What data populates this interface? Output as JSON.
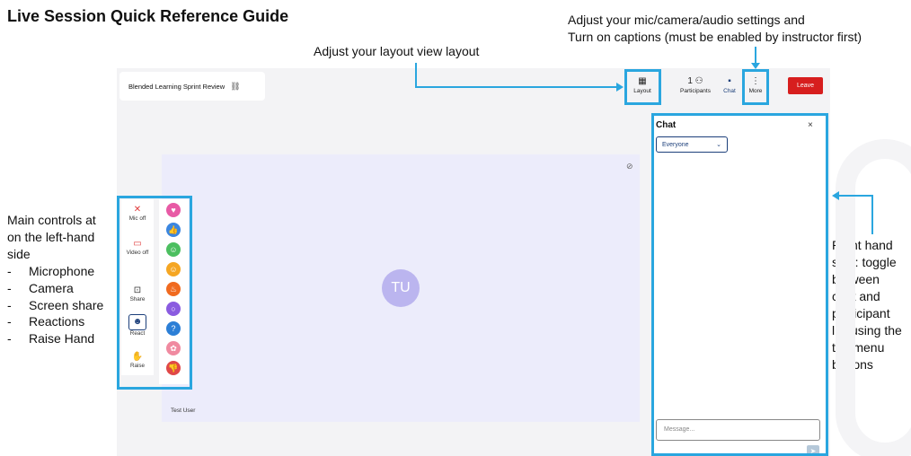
{
  "guide": {
    "title": "Live Session Quick Reference Guide",
    "annot_layout": "Adjust your layout view layout",
    "annot_more_line1": "Adjust your mic/camera/audio settings and",
    "annot_more_line2": "Turn on captions (must be enabled by instructor first)",
    "annot_left_l1": "Main controls at",
    "annot_left_l2": "on the left-hand",
    "annot_left_l3": "side",
    "annot_left_items": [
      "Microphone",
      "Camera",
      "Screen share",
      "Reactions",
      "Raise Hand"
    ],
    "annot_right_l1": "Right hand",
    "annot_right_l2": "side: toggle",
    "annot_right_l3": "between",
    "annot_right_l4": "chat and",
    "annot_right_l5": "participant",
    "annot_right_l6": "list using the",
    "annot_right_l7": "top menu",
    "annot_right_l8": "buttons",
    "highlight_color": "#2aa6df"
  },
  "session": {
    "title": "Blended Learning Sprint Review",
    "link_icon": "link-icon"
  },
  "topbar": {
    "layout_label": "Layout",
    "layout_icon": "grid-icon",
    "participants_count": "1",
    "participants_label": "Participants",
    "participants_icon": "people-icon",
    "chat_label": "Chat",
    "chat_icon": "chat-bubble-icon",
    "more_label": "More",
    "more_icon": "vertical-dots-icon",
    "leave_label": "Leave",
    "leave_color": "#d71e1e"
  },
  "video": {
    "avatar_initials": "TU",
    "name": "Test User",
    "avatar_color": "#bbb5ef",
    "background": "#ececfb"
  },
  "controls": {
    "mic_label": "Mic off",
    "mic_icon": "mic-off-icon",
    "video_label": "Video off",
    "video_icon": "video-off-icon",
    "share_label": "Share",
    "share_icon": "share-screen-icon",
    "react_label": "React",
    "react_icon": "smiley-icon",
    "raise_label": "Raise",
    "raise_icon": "raise-hand-icon"
  },
  "reactions": [
    {
      "icon": "heart-icon",
      "glyph": "♥",
      "color": "#e85aa5"
    },
    {
      "icon": "thumbs-up-icon",
      "glyph": "👍",
      "color": "#3b86e0"
    },
    {
      "icon": "laughing-icon",
      "glyph": "☺",
      "color": "#4cbf60"
    },
    {
      "icon": "smile-icon",
      "glyph": "☺",
      "color": "#f5a623"
    },
    {
      "icon": "fire-icon",
      "glyph": "♨",
      "color": "#f06a1f"
    },
    {
      "icon": "surprised-icon",
      "glyph": "○",
      "color": "#8a5be0"
    },
    {
      "icon": "thinking-icon",
      "glyph": "?",
      "color": "#2c7fd6"
    },
    {
      "icon": "brain-icon",
      "glyph": "✿",
      "color": "#f08aa0"
    },
    {
      "icon": "thumbs-down-icon",
      "glyph": "👎",
      "color": "#e04848"
    }
  ],
  "chat": {
    "title": "Chat",
    "close_glyph": "×",
    "audience": "Everyone",
    "placeholder": "Message..."
  }
}
